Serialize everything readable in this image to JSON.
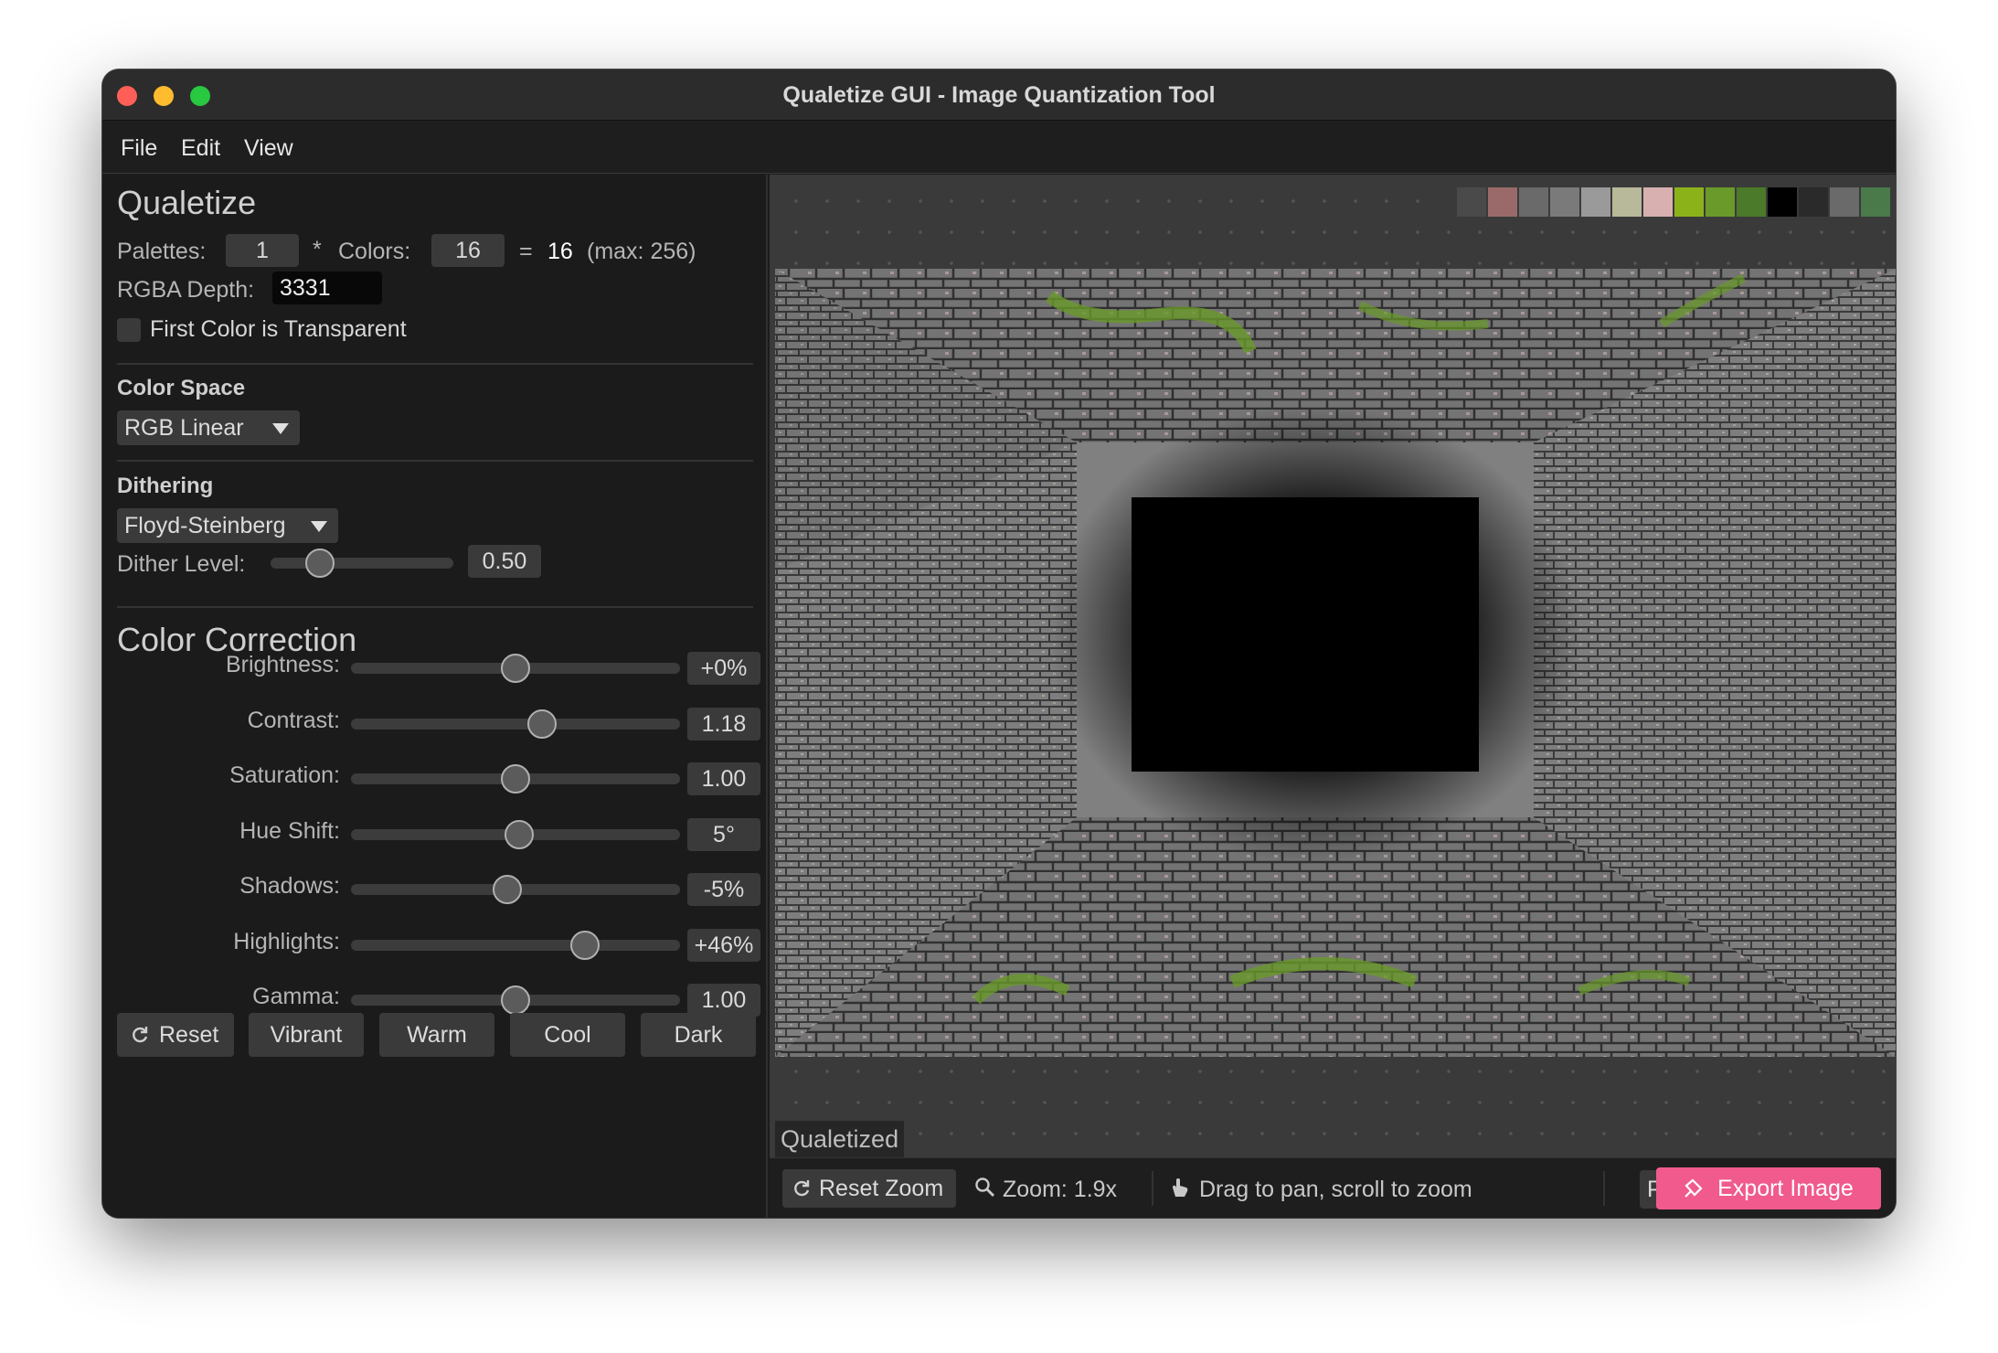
{
  "window": {
    "title": "Qualetize GUI - Image Quantization Tool"
  },
  "menu": [
    "File",
    "Edit",
    "View"
  ],
  "sidebar": {
    "heading": "Qualetize",
    "palettes_label": "Palettes:",
    "palettes_value": "1",
    "times": "*",
    "colors_label": "Colors:",
    "colors_value": "16",
    "equals": "=",
    "total": "16",
    "max_note": "(max: 256)",
    "rgba_label": "RGBA Depth:",
    "rgba_value": "3331",
    "transparent_label": "First Color is Transparent",
    "transparent_checked": false,
    "color_space": {
      "heading": "Color Space",
      "selected": "RGB Linear"
    },
    "dithering": {
      "heading": "Dithering",
      "selected": "Floyd-Steinberg",
      "level_label": "Dither Level:",
      "level_value": "0.50",
      "level_fraction": 0.27
    },
    "color_correction": {
      "heading": "Color Correction",
      "sliders": [
        {
          "label": "Brightness:",
          "value": "+0%",
          "fraction": 0.5
        },
        {
          "label": "Contrast:",
          "value": "1.18",
          "fraction": 0.58
        },
        {
          "label": "Saturation:",
          "value": "1.00",
          "fraction": 0.5
        },
        {
          "label": "Hue Shift:",
          "value": "5°",
          "fraction": 0.51
        },
        {
          "label": "Shadows:",
          "value": "-5%",
          "fraction": 0.475
        },
        {
          "label": "Highlights:",
          "value": "+46%",
          "fraction": 0.71
        },
        {
          "label": "Gamma:",
          "value": "1.00",
          "fraction": 0.5
        }
      ]
    },
    "presets": {
      "reset": "Reset",
      "vibrant": "Vibrant",
      "warm": "Warm",
      "cool": "Cool",
      "dark": "Dark"
    }
  },
  "viewer": {
    "caption": "Qualetized",
    "palette_colors": [
      "#3a3a3a",
      "#4a4a4a",
      "#9a6a6a",
      "#6a6a6a",
      "#7a7a7a",
      "#9a9a9a",
      "#b8b89a",
      "#d8b0b0",
      "#8cb21a",
      "#6a9a2a",
      "#4a7a2a",
      "#000000",
      "#2a2a2a",
      "#6a6a6a",
      "#4a7a4a"
    ]
  },
  "statusbar": {
    "reset_zoom": "Reset Zoom",
    "zoom": "Zoom: 1.9x",
    "hint": "Drag to pan, scroll to zoom",
    "format": "PNG",
    "export": "Export Image"
  },
  "colors": {
    "accent": "#f05a8c",
    "close": "#ff5f57",
    "minimize": "#febc2e",
    "maximize": "#28c840"
  }
}
